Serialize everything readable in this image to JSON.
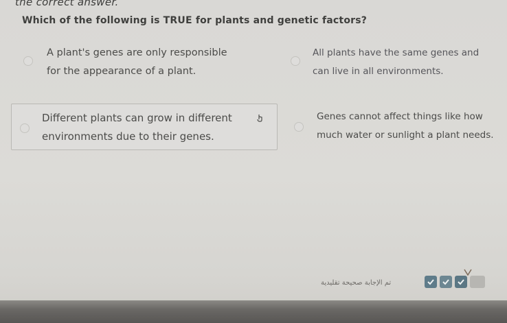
{
  "header": {
    "instruction": "the correct answer."
  },
  "question": {
    "text": "Which of the following is TRUE for plants and genetic factors?"
  },
  "choices": [
    {
      "text": "A plant's genes are only responsible\nfor the appearance of a plant.",
      "selected": false
    },
    {
      "text": "All plants have the same genes and\ncan live in all environments.",
      "selected": false
    },
    {
      "text": "Different plants can grow in different\nenvironments due to their genes.",
      "selected": false
    },
    {
      "text": "Genes cannot affect things like how\nmuch water or sunlight a plant needs.",
      "selected": false
    }
  ],
  "footer": {
    "status_text": "تم الإجابة صحيحة تقليدية",
    "tool_icons": [
      "check-icon",
      "check-icon",
      "check-icon",
      "blank-icon"
    ]
  },
  "colors": {
    "background": "#dcdbd7",
    "selected_border": "#b9b8b4",
    "tool_accent": "#5f7c8a"
  }
}
